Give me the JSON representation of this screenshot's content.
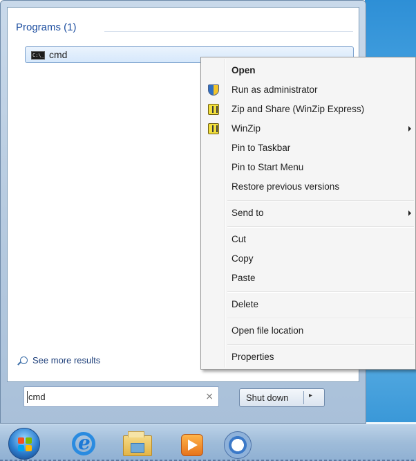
{
  "start_menu": {
    "section_header": "Programs (1)",
    "programs": [
      {
        "label": "cmd",
        "icon": "command-prompt-icon"
      }
    ],
    "see_more": "See more results",
    "search": {
      "value": "cmd",
      "clear_glyph": "×"
    },
    "shutdown": {
      "label": "Shut down",
      "arrow_glyph": "▸"
    }
  },
  "context_menu": {
    "items": [
      {
        "label": "Open",
        "bold": true
      },
      {
        "label": "Run as administrator",
        "icon": "uac-shield-icon"
      },
      {
        "label": "Zip and Share (WinZip Express)",
        "icon": "winzip-icon"
      },
      {
        "label": "WinZip",
        "icon": "winzip-icon",
        "submenu": true
      },
      {
        "label": "Pin to Taskbar"
      },
      {
        "label": "Pin to Start Menu"
      },
      {
        "label": "Restore previous versions"
      },
      {
        "label": "Send to",
        "submenu": true
      },
      {
        "label": "Cut"
      },
      {
        "label": "Copy"
      },
      {
        "label": "Paste"
      },
      {
        "label": "Delete"
      },
      {
        "label": "Open file location"
      },
      {
        "label": "Properties"
      }
    ]
  },
  "taskbar": {
    "items": [
      "start-orb",
      "internet-explorer-icon",
      "windows-explorer-icon",
      "media-player-icon",
      "chrome-icon"
    ]
  },
  "colors": {
    "section_header": "#1e4fa0",
    "highlight_border": "#7da2ce",
    "menu_bg": "#f5f5f5"
  }
}
